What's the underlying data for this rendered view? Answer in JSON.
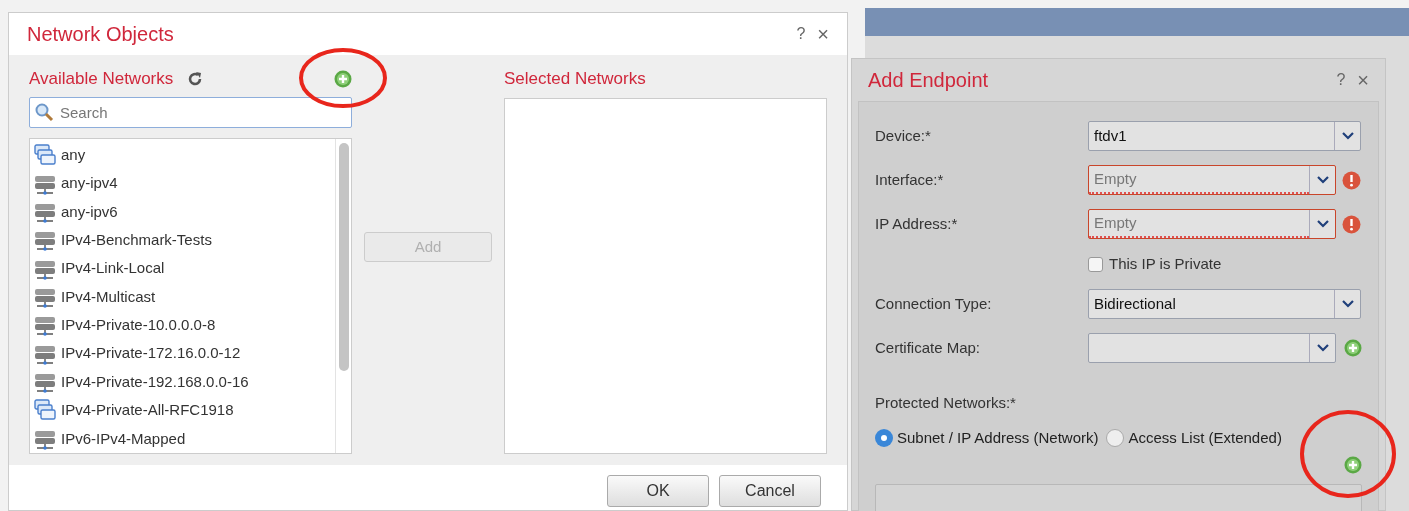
{
  "network_objects": {
    "title": "Network Objects",
    "help": "?",
    "close": "×",
    "available_title": "Available Networks",
    "search": {
      "placeholder": "Search"
    },
    "networks": [
      {
        "name": "any",
        "kind": "group"
      },
      {
        "name": "any-ipv4",
        "kind": "network"
      },
      {
        "name": "any-ipv6",
        "kind": "network"
      },
      {
        "name": "IPv4-Benchmark-Tests",
        "kind": "network"
      },
      {
        "name": "IPv4-Link-Local",
        "kind": "network"
      },
      {
        "name": "IPv4-Multicast",
        "kind": "network"
      },
      {
        "name": "IPv4-Private-10.0.0.0-8",
        "kind": "network"
      },
      {
        "name": "IPv4-Private-172.16.0.0-12",
        "kind": "network"
      },
      {
        "name": "IPv4-Private-192.168.0.0-16",
        "kind": "network"
      },
      {
        "name": "IPv4-Private-All-RFC1918",
        "kind": "group"
      },
      {
        "name": "IPv6-IPv4-Mapped",
        "kind": "network"
      }
    ],
    "add_button": {
      "label": "Add",
      "disabled": true
    },
    "selected_title": "Selected Networks",
    "buttons": [
      "OK",
      "Cancel"
    ]
  },
  "add_endpoint": {
    "title": "Add Endpoint",
    "help": "?",
    "close": "×",
    "fields": [
      {
        "kind": "select",
        "label": "Device:*",
        "value": "ftdv1"
      },
      {
        "kind": "select",
        "label": "Interface:*",
        "placeholder": "Empty",
        "error": true
      },
      {
        "kind": "select",
        "label": "IP Address:*",
        "placeholder": "Empty",
        "error": true
      },
      {
        "kind": "checkbox",
        "label": "This IP is Private",
        "checked": false
      },
      {
        "kind": "select",
        "label": "Connection Type:",
        "value": "Bidirectional"
      },
      {
        "kind": "select",
        "label": "Certificate Map:",
        "addable": true
      }
    ],
    "protected_label": "Protected Networks:*",
    "radios": [
      {
        "label": "Subnet / IP Address (Network)",
        "selected": true
      },
      {
        "label": "Access List (Extended)",
        "selected": false
      }
    ]
  }
}
